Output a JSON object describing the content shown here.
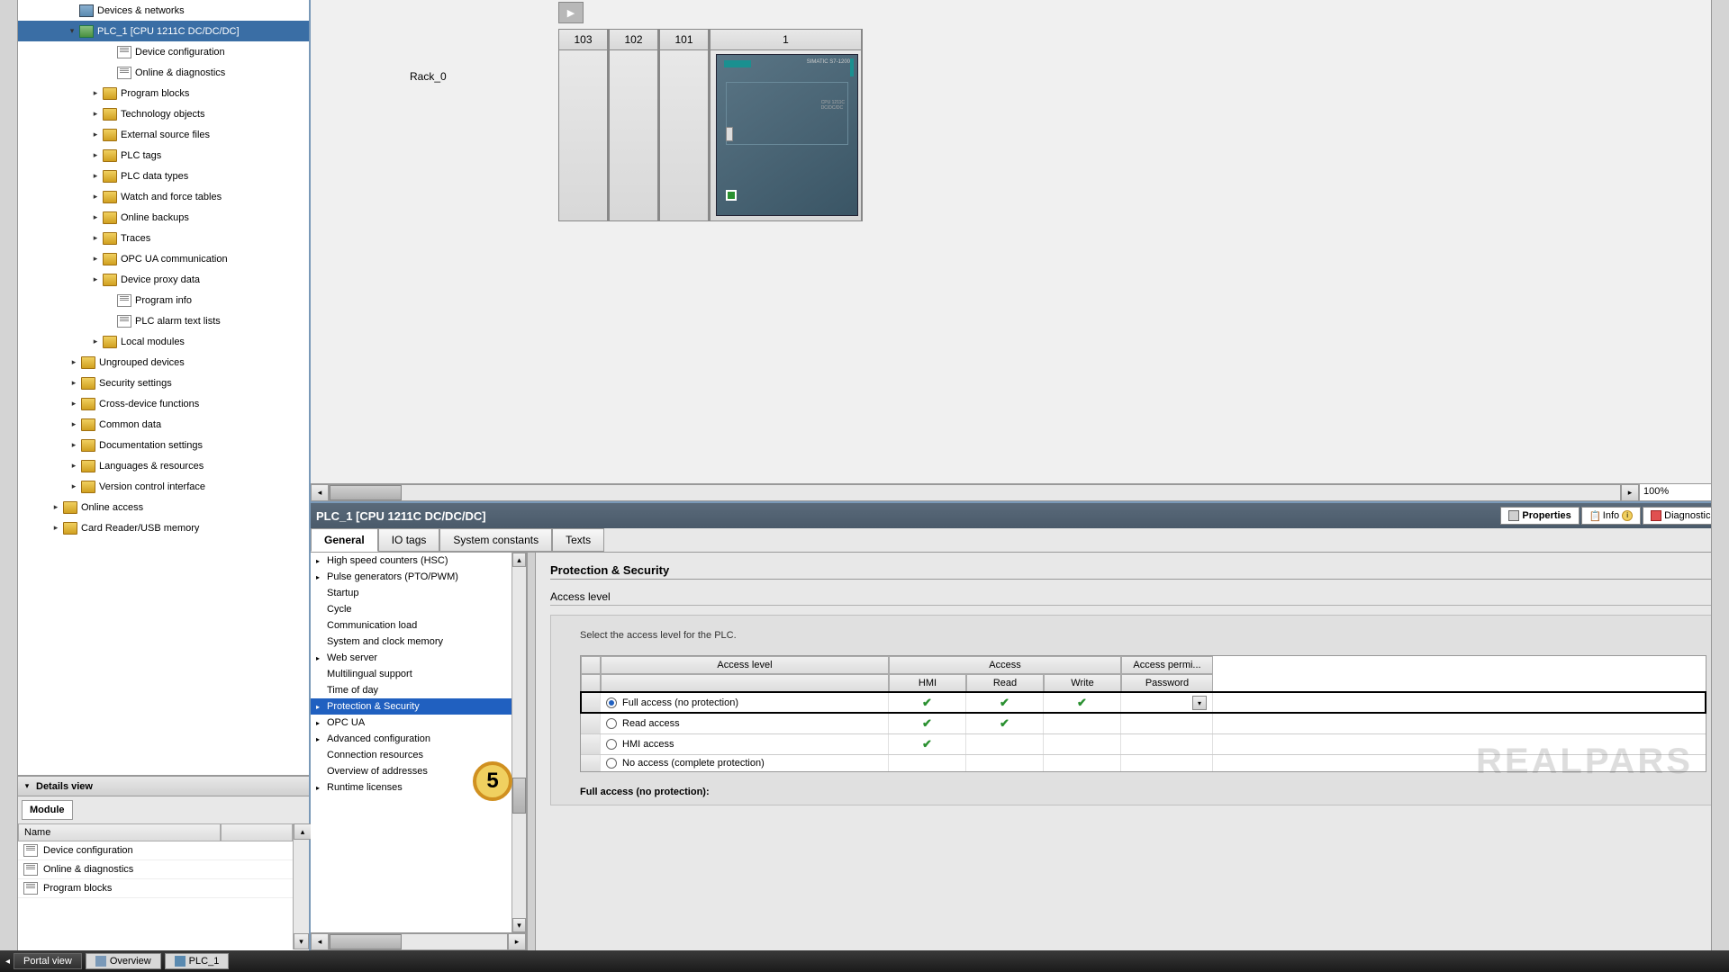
{
  "tree": {
    "items": [
      {
        "label": "Devices & networks",
        "indent": 54,
        "arrow": "",
        "icon": "device",
        "sel": false
      },
      {
        "label": "PLC_1 [CPU 1211C DC/DC/DC]",
        "indent": 54,
        "arrow": "▾",
        "icon": "plc",
        "sel": true
      },
      {
        "label": "Device configuration",
        "indent": 96,
        "arrow": "",
        "icon": "page",
        "sel": false
      },
      {
        "label": "Online & diagnostics",
        "indent": 96,
        "arrow": "",
        "icon": "page",
        "sel": false
      },
      {
        "label": "Program blocks",
        "indent": 80,
        "arrow": "▸",
        "icon": "folder",
        "sel": false
      },
      {
        "label": "Technology objects",
        "indent": 80,
        "arrow": "▸",
        "icon": "folder",
        "sel": false
      },
      {
        "label": "External source files",
        "indent": 80,
        "arrow": "▸",
        "icon": "folder",
        "sel": false
      },
      {
        "label": "PLC tags",
        "indent": 80,
        "arrow": "▸",
        "icon": "folder",
        "sel": false
      },
      {
        "label": "PLC data types",
        "indent": 80,
        "arrow": "▸",
        "icon": "folder",
        "sel": false
      },
      {
        "label": "Watch and force tables",
        "indent": 80,
        "arrow": "▸",
        "icon": "folder",
        "sel": false
      },
      {
        "label": "Online backups",
        "indent": 80,
        "arrow": "▸",
        "icon": "folder",
        "sel": false
      },
      {
        "label": "Traces",
        "indent": 80,
        "arrow": "▸",
        "icon": "folder",
        "sel": false
      },
      {
        "label": "OPC UA communication",
        "indent": 80,
        "arrow": "▸",
        "icon": "folder",
        "sel": false
      },
      {
        "label": "Device proxy data",
        "indent": 80,
        "arrow": "▸",
        "icon": "folder",
        "sel": false
      },
      {
        "label": "Program info",
        "indent": 96,
        "arrow": "",
        "icon": "page",
        "sel": false
      },
      {
        "label": "PLC alarm text lists",
        "indent": 96,
        "arrow": "",
        "icon": "page",
        "sel": false
      },
      {
        "label": "Local modules",
        "indent": 80,
        "arrow": "▸",
        "icon": "folder",
        "sel": false
      },
      {
        "label": "Ungrouped devices",
        "indent": 56,
        "arrow": "▸",
        "icon": "folder",
        "sel": false
      },
      {
        "label": "Security settings",
        "indent": 56,
        "arrow": "▸",
        "icon": "folder",
        "sel": false
      },
      {
        "label": "Cross-device functions",
        "indent": 56,
        "arrow": "▸",
        "icon": "folder",
        "sel": false
      },
      {
        "label": "Common data",
        "indent": 56,
        "arrow": "▸",
        "icon": "folder",
        "sel": false
      },
      {
        "label": "Documentation settings",
        "indent": 56,
        "arrow": "▸",
        "icon": "folder",
        "sel": false
      },
      {
        "label": "Languages & resources",
        "indent": 56,
        "arrow": "▸",
        "icon": "folder",
        "sel": false
      },
      {
        "label": "Version control interface",
        "indent": 56,
        "arrow": "▸",
        "icon": "folder",
        "sel": false
      },
      {
        "label": "Online access",
        "indent": 36,
        "arrow": "▸",
        "icon": "folder",
        "sel": false
      },
      {
        "label": "Card Reader/USB memory",
        "indent": 36,
        "arrow": "▸",
        "icon": "folder",
        "sel": false
      }
    ]
  },
  "details": {
    "title": "Details view",
    "tab": "Module",
    "name_header": "Name",
    "rows": [
      "Device configuration",
      "Online & diagnostics",
      "Program blocks"
    ]
  },
  "device": {
    "rack_label": "Rack_0",
    "slots": [
      "103",
      "102",
      "101",
      "1"
    ],
    "zoom": "100%"
  },
  "props": {
    "title": "PLC_1 [CPU 1211C DC/DC/DC]",
    "right_tabs": [
      "Properties",
      "Info",
      "Diagnostics"
    ],
    "sub_tabs": [
      "General",
      "IO tags",
      "System constants",
      "Texts"
    ],
    "nav": [
      {
        "label": "High speed counters (HSC)",
        "arrow": "▸",
        "sel": false
      },
      {
        "label": "Pulse generators (PTO/PWM)",
        "arrow": "▸",
        "sel": false
      },
      {
        "label": "Startup",
        "arrow": "",
        "sel": false
      },
      {
        "label": "Cycle",
        "arrow": "",
        "sel": false
      },
      {
        "label": "Communication load",
        "arrow": "",
        "sel": false
      },
      {
        "label": "System and clock memory",
        "arrow": "",
        "sel": false
      },
      {
        "label": "Web server",
        "arrow": "▸",
        "sel": false
      },
      {
        "label": "Multilingual support",
        "arrow": "",
        "sel": false
      },
      {
        "label": "Time of day",
        "arrow": "",
        "sel": false
      },
      {
        "label": "Protection & Security",
        "arrow": "▸",
        "sel": true
      },
      {
        "label": "OPC UA",
        "arrow": "▸",
        "sel": false
      },
      {
        "label": "Advanced configuration",
        "arrow": "▸",
        "sel": false
      },
      {
        "label": "Connection resources",
        "arrow": "",
        "sel": false
      },
      {
        "label": "Overview of addresses",
        "arrow": "",
        "sel": false
      },
      {
        "label": "Runtime licenses",
        "arrow": "▸",
        "sel": false
      }
    ],
    "section": "Protection & Security",
    "subsection": "Access level",
    "instruction": "Select the access level for the PLC.",
    "table": {
      "headers": {
        "level": "Access level",
        "access": "Access",
        "permi": "Access permi..."
      },
      "sub": {
        "hmi": "HMI",
        "read": "Read",
        "write": "Write",
        "password": "Password"
      },
      "rows": [
        {
          "label": "Full access (no protection)",
          "checked": true,
          "hmi": true,
          "read": true,
          "write": true,
          "highlighted": true,
          "dd": true
        },
        {
          "label": "Read access",
          "checked": false,
          "hmi": true,
          "read": true,
          "write": false,
          "highlighted": false,
          "dd": false
        },
        {
          "label": "HMI access",
          "checked": false,
          "hmi": true,
          "read": false,
          "write": false,
          "highlighted": false,
          "dd": false
        },
        {
          "label": "No access (complete protection)",
          "checked": false,
          "hmi": false,
          "read": false,
          "write": false,
          "highlighted": false,
          "dd": false
        }
      ]
    },
    "desc": "Full access (no protection):"
  },
  "callout": "5",
  "watermark": "REALPARS",
  "bottom": {
    "portal": "Portal view",
    "overview": "Overview",
    "plc": "PLC_1"
  }
}
